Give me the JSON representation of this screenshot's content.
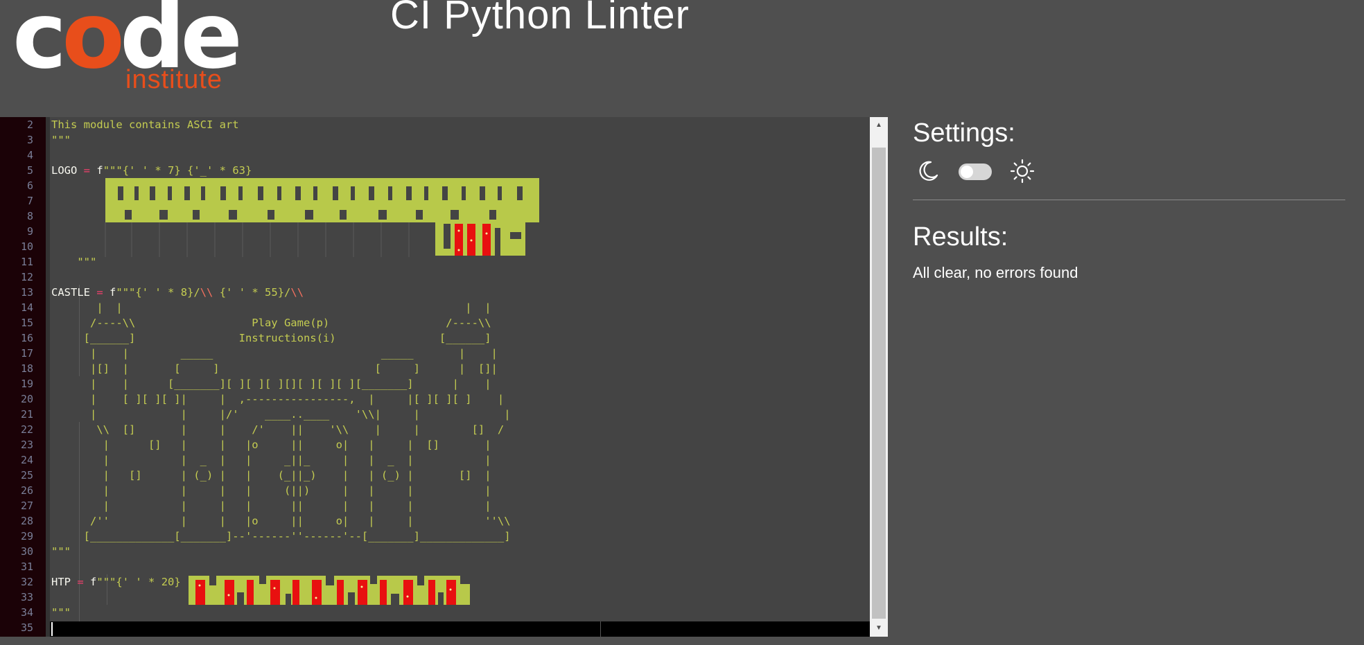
{
  "header": {
    "logo_text_main_1": "c",
    "logo_text_main_o": "o",
    "logo_text_main_2": "de",
    "logo_text_sub": "institute",
    "title": "CI Python Linter"
  },
  "colors": {
    "brand_orange": "#e84e1b",
    "background": "#4f4f4f",
    "editor_bg": "#444444",
    "gutter_bg": "#1b0207",
    "string_color": "#c4cc51",
    "operator_color": "#f23f6d",
    "art_green": "#b8c94a",
    "art_red": "#e81010"
  },
  "editor": {
    "lines": [
      {
        "n": "2",
        "t": "This module contains ASCI art",
        "cls": "str"
      },
      {
        "n": "3",
        "t": "\"\"\"",
        "cls": "str"
      },
      {
        "n": "4",
        "t": "",
        "cls": ""
      },
      {
        "n": "5",
        "t": "",
        "cls": ""
      },
      {
        "n": "6",
        "t": "",
        "cls": ""
      },
      {
        "n": "7",
        "t": "",
        "cls": ""
      },
      {
        "n": "8",
        "t": "",
        "cls": ""
      },
      {
        "n": "9",
        "t": "",
        "cls": ""
      },
      {
        "n": "10",
        "t": "",
        "cls": ""
      },
      {
        "n": "11",
        "t": "    \"\"\"",
        "cls": "str"
      },
      {
        "n": "12",
        "t": "",
        "cls": ""
      },
      {
        "n": "13",
        "t": "",
        "cls": ""
      },
      {
        "n": "14",
        "t": "       |  |                                                     |  |",
        "cls": "str"
      },
      {
        "n": "15",
        "t": "      /----\\\\                  Play Game(p)                  /----\\\\",
        "cls": "str"
      },
      {
        "n": "16",
        "t": "     [______]                Instructions(i)                [______]",
        "cls": "str"
      },
      {
        "n": "17",
        "t": "      |    |        _____                          _____       |    |",
        "cls": "str"
      },
      {
        "n": "18",
        "t": "      |[]  |       [     ]                        [     ]      |  []|",
        "cls": "str"
      },
      {
        "n": "19",
        "t": "      |    |      [_______][ ][ ][ ][][ ][ ][ ][_______]      |    |",
        "cls": "str"
      },
      {
        "n": "20",
        "t": "      |    [ ][ ][ ]|     |  ,----------------,  |     |[ ][ ][ ]    |",
        "cls": "str"
      },
      {
        "n": "21",
        "t": "      |             |     |/'    ____..____    '\\\\|     |             |",
        "cls": "str"
      },
      {
        "n": "22",
        "t": "       \\\\  []       |     |    /'    ||    '\\\\    |     |        []  /",
        "cls": "str"
      },
      {
        "n": "23",
        "t": "        |      []   |     |   |o     ||     o|   |     |  []       |",
        "cls": "str"
      },
      {
        "n": "24",
        "t": "        |           |  _  |   |     _||_     |   |  _  |           |",
        "cls": "str"
      },
      {
        "n": "25",
        "t": "        |   []      | (_) |   |    (_||_)    |   | (_) |       []  |",
        "cls": "str"
      },
      {
        "n": "26",
        "t": "        |           |     |   |     (||)     |   |     |           |",
        "cls": "str"
      },
      {
        "n": "27",
        "t": "        |           |     |   |      ||      |   |     |           |",
        "cls": "str"
      },
      {
        "n": "28",
        "t": "      /''           |     |   |o     ||     o|   |     |           ''\\\\",
        "cls": "str"
      },
      {
        "n": "29",
        "t": "     [_____________[_______]--'------''------'--[_______]_____________]",
        "cls": "str"
      },
      {
        "n": "30",
        "t": "\"\"\"",
        "cls": "str"
      },
      {
        "n": "31",
        "t": "",
        "cls": ""
      },
      {
        "n": "32",
        "t": "",
        "cls": ""
      },
      {
        "n": "33",
        "t": "",
        "cls": ""
      },
      {
        "n": "34",
        "t": "\"\"\"",
        "cls": "str"
      },
      {
        "n": "35",
        "t": "",
        "cls": ""
      }
    ],
    "line5_var": "LOGO",
    "line5_op": "=",
    "line5_prefix": "f",
    "line5_str": "\"\"\"{' ' * 7} {'_' * 63}",
    "line13_var": "CASTLE",
    "line13_op": "=",
    "line13_prefix": "f",
    "line13_str1": "\"\"\"{' ' * 8}/",
    "line13_esc1": "\\\\",
    "line13_str2": " {' ' * 55}/",
    "line13_esc2": "\\\\",
    "line32_var": "HTP",
    "line32_op": "=",
    "line32_prefix": "f",
    "line32_str": "\"\"\"{' ' * 20}"
  },
  "settings": {
    "title": "Settings:",
    "moon_icon": "moon-icon",
    "sun_icon": "sun-icon",
    "dark_mode": false
  },
  "results": {
    "title": "Results:",
    "message": "All clear, no errors found"
  }
}
